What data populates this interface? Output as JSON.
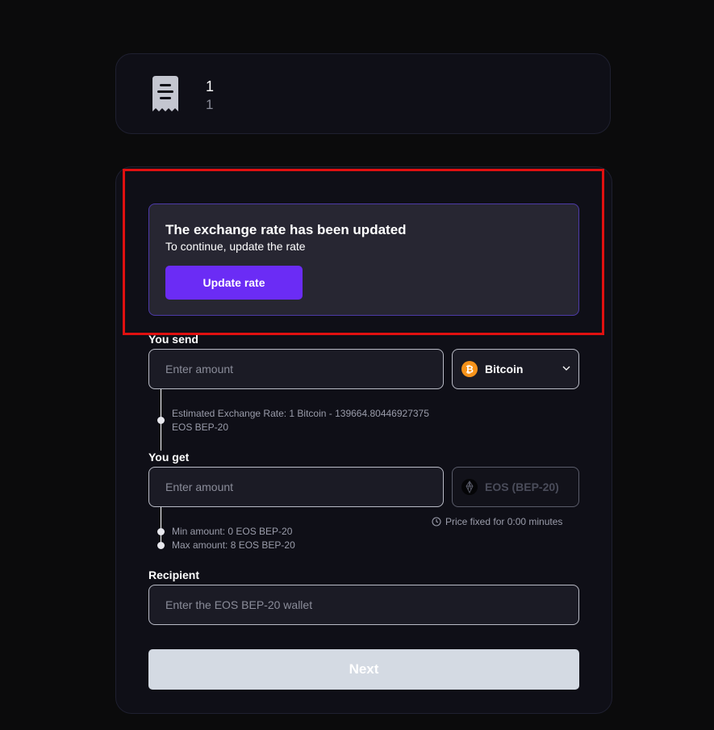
{
  "order": {
    "title": "1",
    "subtitle": "1",
    "icon": "receipt-icon"
  },
  "alert": {
    "title": "The exchange rate has been updated",
    "subtitle": "To continue, update the rate",
    "button_label": "Update rate"
  },
  "send": {
    "label": "You send",
    "placeholder": "Enter amount",
    "currency": "Bitcoin",
    "currency_icon": "bitcoin-icon",
    "rate_line1": "Estimated Exchange Rate: 1 Bitcoin - 139664.80446927375",
    "rate_line2": "EOS BEP-20"
  },
  "get": {
    "label": "You get",
    "placeholder": "Enter amount",
    "currency": "EOS (BEP-20)",
    "currency_icon": "eos-icon",
    "price_fixed": "Price fixed for 0:00 minutes",
    "min_amount": "Min amount: 0 EOS BEP-20",
    "max_amount": "Max amount: 8 EOS BEP-20"
  },
  "recipient": {
    "label": "Recipient",
    "placeholder": "Enter the EOS BEP-20 wallet"
  },
  "next_label": "Next",
  "colors": {
    "accent": "#6b2cf5",
    "highlight": "#e01010",
    "bitcoin": "#f7931a"
  }
}
